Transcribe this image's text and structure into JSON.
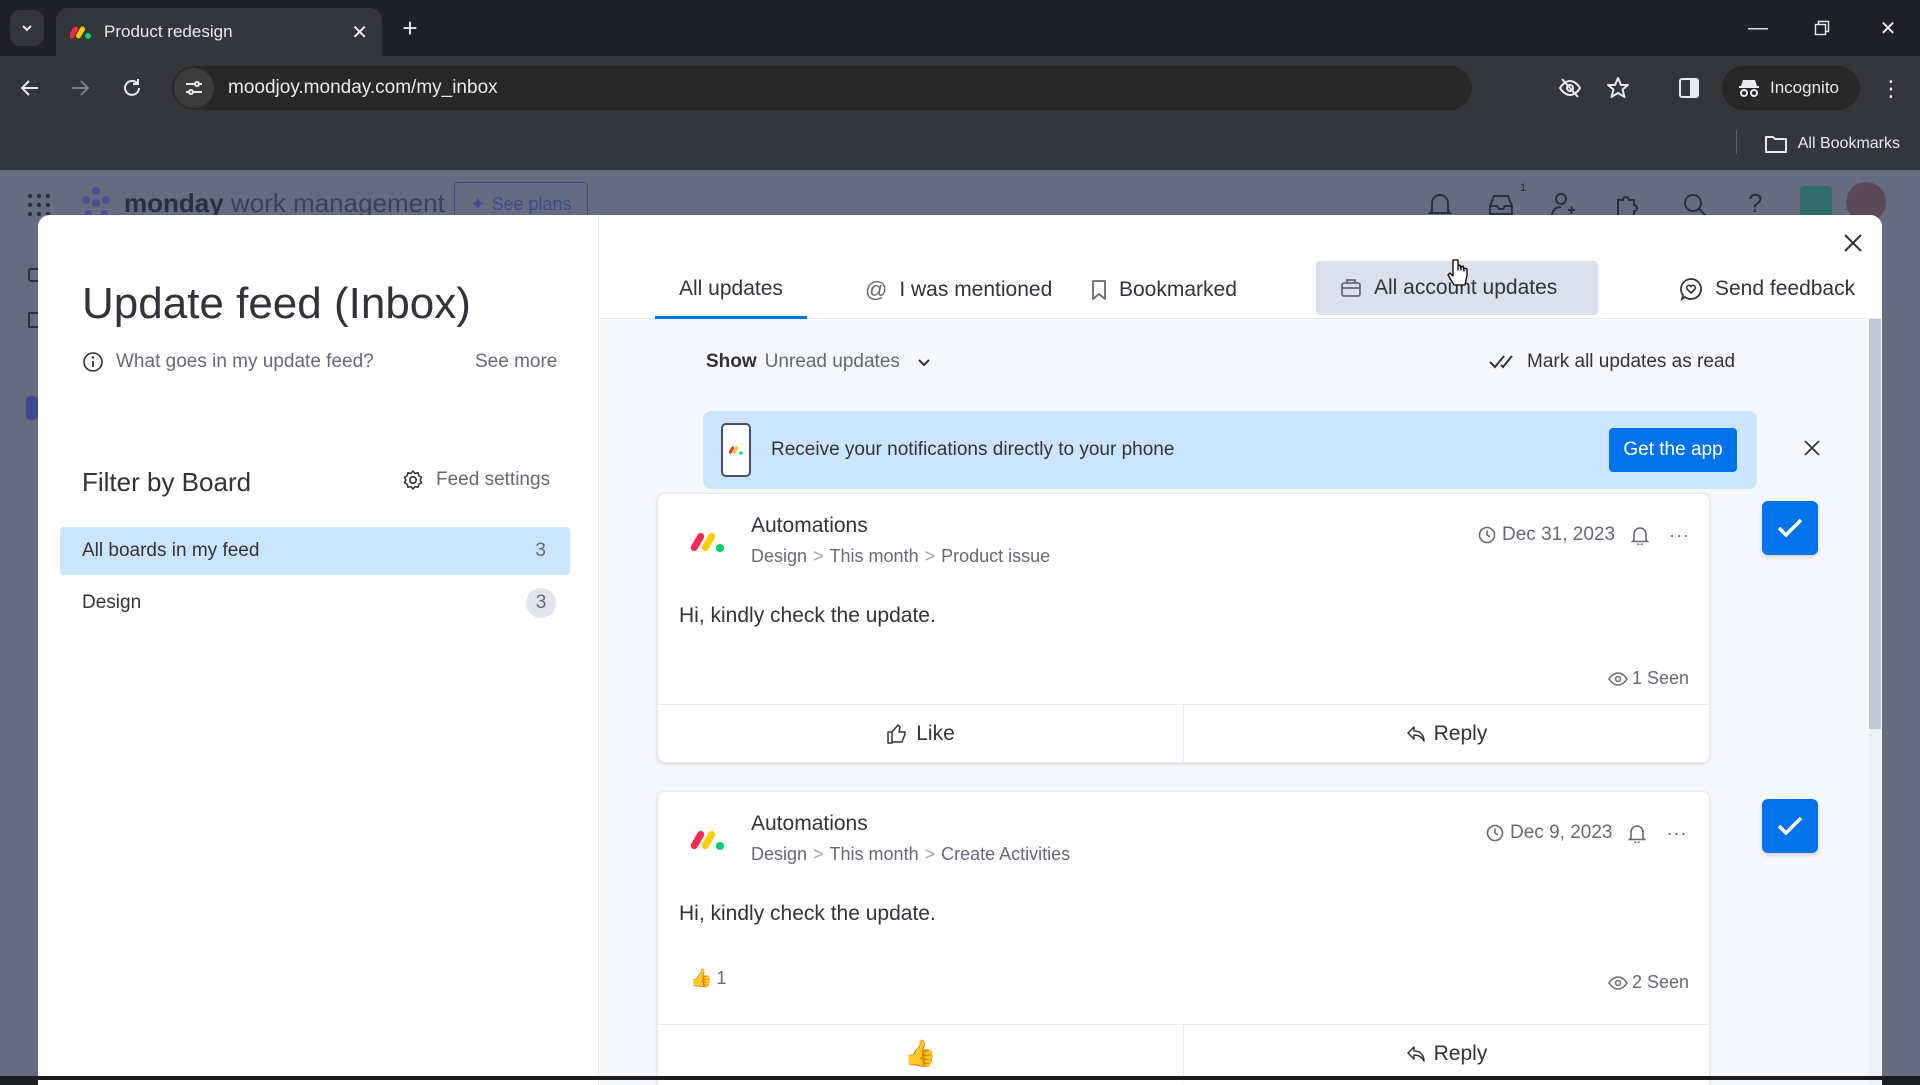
{
  "browser": {
    "tab_title": "Product redesign",
    "url": "moodjoy.monday.com/my_inbox",
    "profile_label": "Incognito",
    "bookmarks_label": "All Bookmarks"
  },
  "app_header": {
    "brand_bold": "monday",
    "brand_light": "work management",
    "see_plans_label": "See plans",
    "inbox_badge": "1"
  },
  "left_panel": {
    "title": "Update feed",
    "title_suffix": "(Inbox)",
    "info_text": "What goes in my update feed?",
    "see_more_label": "See more",
    "filter_title": "Filter by Board",
    "feed_settings_label": "Feed settings",
    "boards": [
      {
        "label": "All boards in my feed",
        "count": "3",
        "selected": true
      },
      {
        "label": "Design",
        "count": "3",
        "selected": false
      }
    ]
  },
  "tabs": [
    {
      "label": "All updates",
      "icon": "",
      "active": true
    },
    {
      "label": "I was mentioned",
      "icon": "at-icon",
      "active": false
    },
    {
      "label": "Bookmarked",
      "icon": "bookmark-icon",
      "active": false
    },
    {
      "label": "All account updates",
      "icon": "briefcase-icon",
      "active": false
    }
  ],
  "send_feedback_label": "Send feedback",
  "filter": {
    "show_label": "Show",
    "show_value": "Unread updates",
    "mark_all_label": "Mark all updates as read"
  },
  "banner": {
    "text": "Receive your notifications directly to your phone",
    "button_label": "Get the app"
  },
  "updates": [
    {
      "author": "Automations",
      "breadcrumb": [
        "Design",
        "This month",
        "Product issue"
      ],
      "date": "Dec 31, 2023",
      "body": "Hi, kindly check the update.",
      "seen": "1 Seen",
      "likes": "",
      "like_label": "Like",
      "reply_label": "Reply",
      "read": true
    },
    {
      "author": "Automations",
      "breadcrumb": [
        "Design",
        "This month",
        "Create Activities"
      ],
      "date": "Dec 9, 2023",
      "body": "Hi, kindly check the update.",
      "seen": "2 Seen",
      "likes": "1",
      "like_label": "",
      "reply_label": "Reply",
      "read": true
    }
  ],
  "colors": {
    "primary": "#0073ea",
    "selected_bg": "#cce5ff",
    "banner_bg": "#cce5ff",
    "text": "#323338",
    "muted": "#676879"
  }
}
